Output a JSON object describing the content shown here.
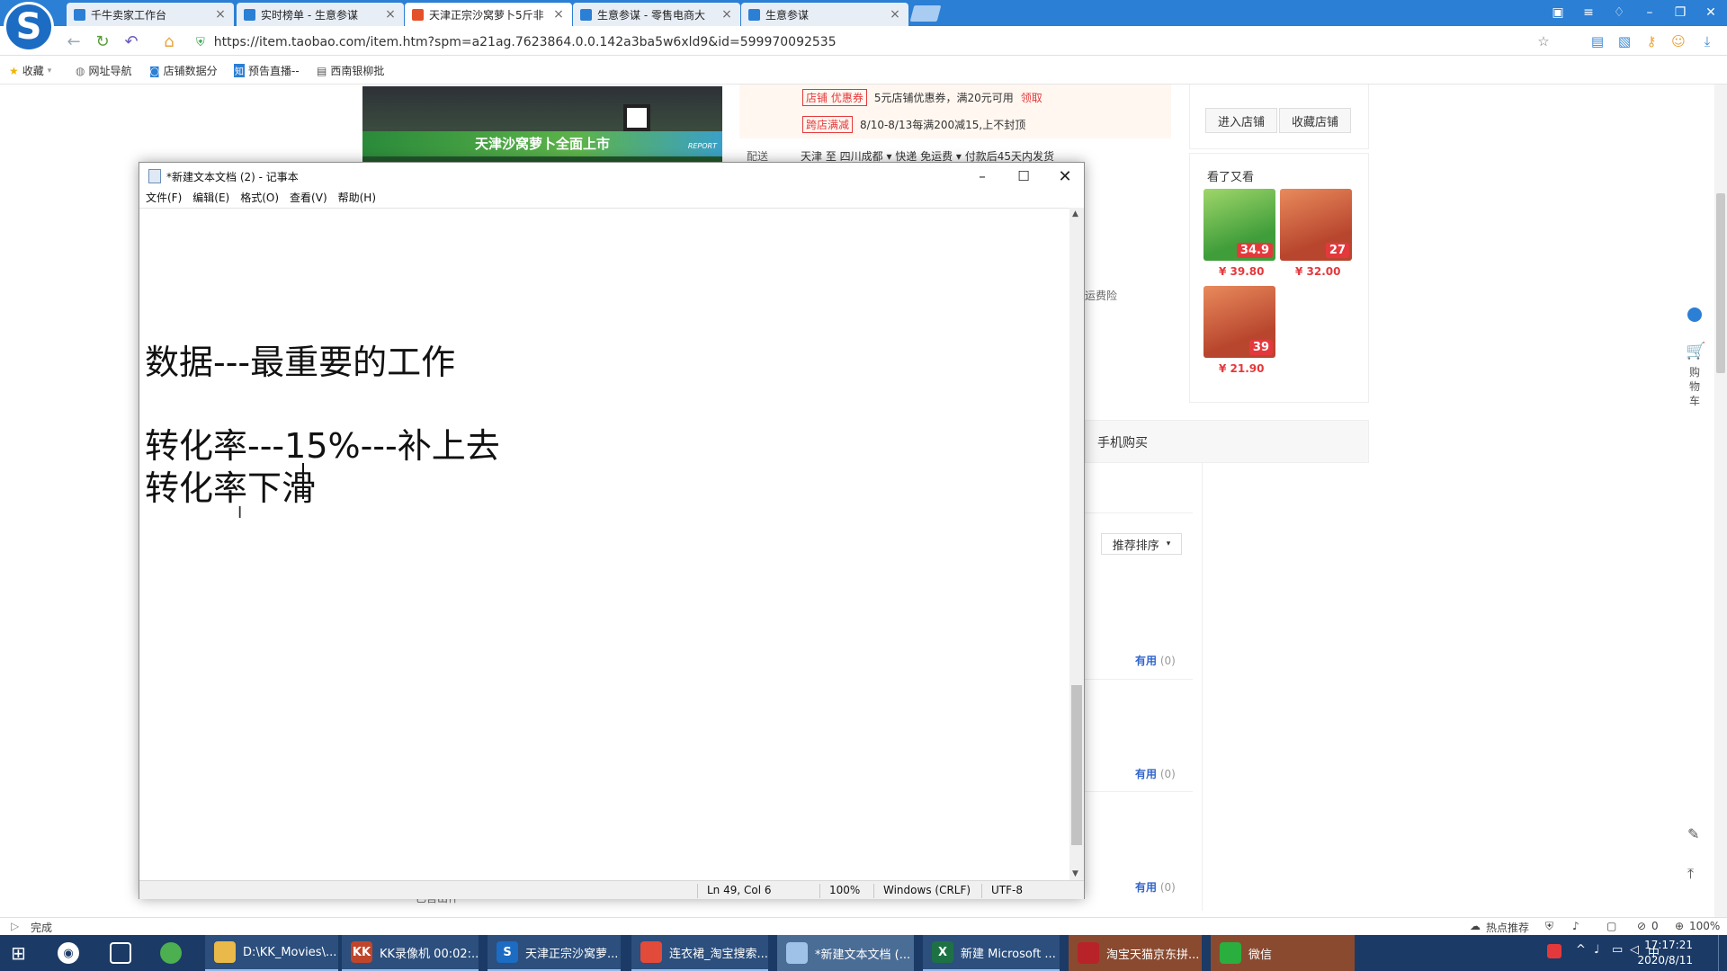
{
  "browser": {
    "logo_letter": "S",
    "tabs": [
      {
        "label": "千牛卖家工作台",
        "active": false
      },
      {
        "label": "实时榜单 - 生意参谋",
        "active": false
      },
      {
        "label": "天津正宗沙窝萝卜5斤非",
        "active": true
      },
      {
        "label": "生意参谋 - 零售电商大",
        "active": false
      },
      {
        "label": "生意参谋",
        "active": false
      }
    ],
    "url": "https://item.taobao.com/item.htm?spm=a21ag.7623864.0.0.142a3ba5w6xld9&id=599970092535",
    "favorites": [
      {
        "label": "收藏",
        "icon": "star-icon"
      },
      {
        "label": "网址导航",
        "icon": "globe-icon"
      },
      {
        "label": "店铺数据分",
        "icon": "shop-icon"
      },
      {
        "label": "预告直播--",
        "icon": "zhi-icon"
      },
      {
        "label": "西南银柳批",
        "icon": "doc-icon"
      }
    ],
    "status_left": "完成",
    "status_right": [
      "热点推荐",
      "0",
      "100%"
    ]
  },
  "page": {
    "banner_text": "天津沙窝萝卜全面上市",
    "banner_corner": "REPORT",
    "coupon1_tag": "店铺 优惠券",
    "coupon1_text": "5元店铺优惠券，满20元可用",
    "coupon1_link": "领取",
    "coupon2_tag": "跨店满减",
    "coupon2_text": "8/10-8/13每满200减15,上不封顶",
    "delivery_label": "配送",
    "delivery_text": "天津 至  四川成都 ▾   快递 免运费 ▾   付款后45天内发货",
    "enter_shop": "进入店铺",
    "fav_shop": "收藏店铺",
    "seen_title": "看了又看",
    "products": [
      {
        "price": "¥ 39.80",
        "colorA": "#3f9d3a",
        "colorB": "#9fd66a",
        "badge": "34.9"
      },
      {
        "price": "¥ 32.00",
        "colorA": "#b8462e",
        "colorB": "#e98a5c",
        "badge": "27"
      },
      {
        "price": "¥ 21.90",
        "colorA": "#b8462e",
        "colorB": "#e98a5c",
        "badge": "39"
      }
    ],
    "insurance_text": "运费险",
    "mobile_buy": "手机购买",
    "sort_label": "推荐排序",
    "helpful_label": "有用",
    "helpful_count": "(0)",
    "cart_label": "购物车",
    "bottom_text": "已售出件"
  },
  "notepad": {
    "title": "*新建文本文档 (2) - 记事本",
    "menu": [
      "文件(F)",
      "编辑(E)",
      "格式(O)",
      "查看(V)",
      "帮助(H)"
    ],
    "lines": [
      "数据---最重要的工作",
      "转化率---15%---补上去",
      "转化率下滑"
    ],
    "status": {
      "position": "Ln 49, Col 6",
      "zoom": "100%",
      "line_ending": "Windows (CRLF)",
      "encoding": "UTF-8"
    }
  },
  "taskbar": {
    "items": [
      {
        "label": "D:\\KK_Movies\\...",
        "icon_color": "#e9b949",
        "icon_text": ""
      },
      {
        "label": "KK录像机 00:02:...",
        "icon_color": "#c0462b",
        "icon_text": "KK"
      },
      {
        "label": "天津正宗沙窝萝...",
        "icon_color": "#1c6cc4",
        "icon_text": "S"
      },
      {
        "label": "连衣裙_淘宝搜索...",
        "icon_color": "#e24a3a",
        "icon_text": ""
      },
      {
        "label": "*新建文本文档 (...",
        "icon_color": "#9fc3e8",
        "icon_text": ""
      },
      {
        "label": "新建 Microsoft ...",
        "icon_color": "#1e7145",
        "icon_text": "X"
      },
      {
        "label": "淘宝天猫京东拼...",
        "icon_color": "#b8232a",
        "icon_text": ""
      },
      {
        "label": "微信",
        "icon_color": "#2aae3d",
        "icon_text": ""
      }
    ],
    "time": "17:17:21",
    "date": "2020/8/11"
  }
}
